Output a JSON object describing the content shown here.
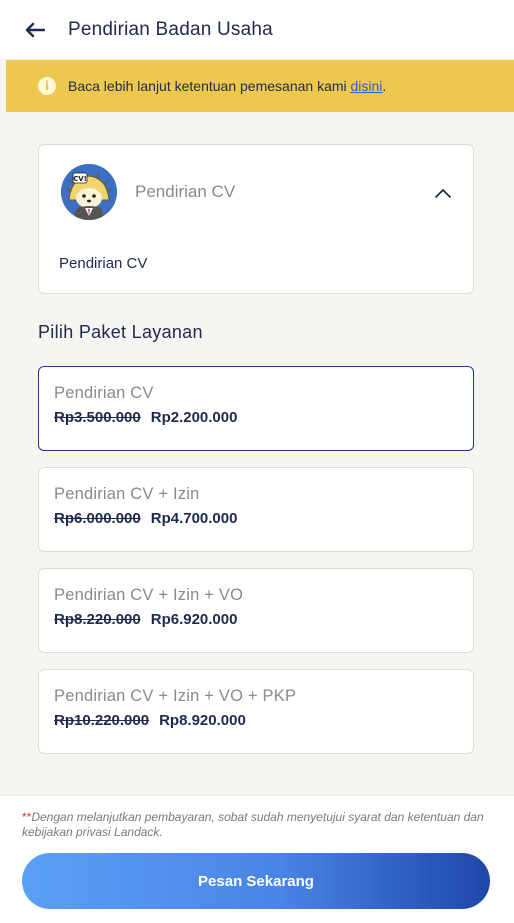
{
  "header": {
    "title": "Pendirian Badan Usaha"
  },
  "notice": {
    "text": "Baca lebih lanjut ketentuan pemesanan kami ",
    "link": "disini",
    "suffix": "."
  },
  "service": {
    "name": "Pendirian CV",
    "description": "Pendirian CV",
    "avatar_label": "CV!"
  },
  "section_title": "Pilih Paket Layanan",
  "packages": [
    {
      "name": "Pendirian CV",
      "old_price": "Rp3.500.000",
      "new_price": "Rp2.200.000"
    },
    {
      "name": "Pendirian CV + Izin",
      "old_price": "Rp6.000.000",
      "new_price": "Rp4.700.000"
    },
    {
      "name": "Pendirian CV + Izin + VO",
      "old_price": "Rp8.220.000",
      "new_price": "Rp6.920.000"
    },
    {
      "name": "Pendirian CV + Izin + VO + PKP",
      "old_price": "Rp10.220.000",
      "new_price": "Rp8.920.000"
    }
  ],
  "footer": {
    "asterisk": "**",
    "disclaimer": "Dengan melanjutkan pembayaran, sobat sudah menyetujui syarat dan ketentuan dan kebijakan privasi Landack.",
    "cta_label": "Pesan Sekarang"
  },
  "colors": {
    "accent": "#1e3a8a",
    "notice_bg": "#ecc84f",
    "cta_start": "#5aa0f5",
    "cta_end": "#1e47a8"
  }
}
